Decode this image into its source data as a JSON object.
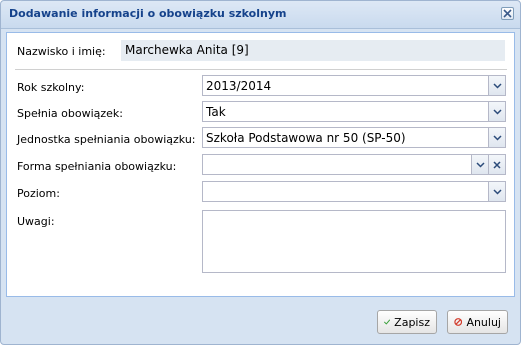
{
  "window": {
    "title": "Dodawanie informacji o obowiązku szkolnym"
  },
  "fields": {
    "name_label": "Nazwisko i imię:",
    "name_value": "Marchewka Anita  [9]",
    "year_label": "Rok szkolny:",
    "year_value": "2013/2014",
    "fulfils_label": "Spełnia obowiązek:",
    "fulfils_value": "Tak",
    "unit_label": "Jednostka spełniania obowiązku:",
    "unit_value": "Szkoła Podstawowa nr 50 (SP-50)",
    "form_label": "Forma spełniania obowiązku:",
    "form_value": "",
    "level_label": "Poziom:",
    "level_value": "",
    "notes_label": "Uwagi:",
    "notes_value": ""
  },
  "buttons": {
    "save": "Zapisz",
    "cancel": "Anuluj"
  },
  "colors": {
    "title": "#15428b",
    "save_icon": "#3aa03a",
    "cancel_icon": "#d23a2a"
  }
}
